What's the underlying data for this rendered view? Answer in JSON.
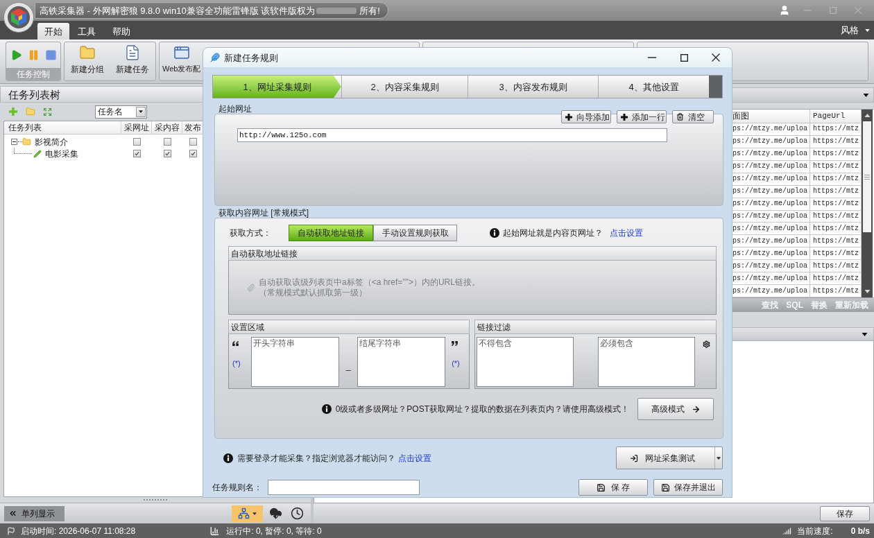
{
  "app": {
    "title": "高铁采集器 - 外网解密狼 9.8.0 win10兼容全功能雷锋版  该软件版权为",
    "title_end": "所有!"
  },
  "menu": {
    "tabs": [
      {
        "label": "开始",
        "selected": true
      },
      {
        "label": "工具",
        "selected": false
      },
      {
        "label": "帮助",
        "selected": false
      }
    ],
    "style_menu": "风格"
  },
  "ribbon": {
    "control_group": "任务控制",
    "buttons": [
      "新建分组",
      "新建任务",
      "Web发布配"
    ]
  },
  "task_tree": {
    "title": "任务列表树",
    "filter": "任务名",
    "columns": [
      "任务列表",
      "采网址",
      "采内容",
      "发布"
    ],
    "nodes": [
      {
        "name": "影视简介",
        "kind": "group",
        "expanded": true,
        "checks": [
          false,
          false,
          false
        ],
        "children": [
          {
            "name": "电影采集",
            "kind": "task",
            "checks": [
              true,
              true,
              true
            ]
          }
        ]
      }
    ],
    "view_toggle": "单列显示"
  },
  "result_table": {
    "columns": [
      "面图",
      "PageUrl"
    ],
    "rows": [
      [
        "ps://mtzy.me/uploa",
        "https://mtz"
      ],
      [
        "ps://mtzy.me/uploa",
        "https://mtz"
      ],
      [
        "ps://mtzy.me/uploa",
        "https://mtz"
      ],
      [
        "ps://mtzy.me/uploa",
        "https://mtz"
      ],
      [
        "ps://mtzy.me/uploa",
        "https://mtz"
      ],
      [
        "ps://mtzy.me/uploa",
        "https://mtz"
      ],
      [
        "ps://mtzy.me/uploa",
        "https://mtz"
      ],
      [
        "ps://mtzy.me/uploa",
        "https://mtz"
      ],
      [
        "ps://mtzy.me/uploa",
        "https://mtz"
      ],
      [
        "ps://mtzy.me/uploa",
        "https://mtz"
      ],
      [
        "ps://mtzy.me/uploa",
        "https://mtz"
      ],
      [
        "ps://mtzy.me/uploa",
        "https://mtz"
      ],
      [
        "ps://mtzy.me/uploa",
        "https://mtz"
      ],
      [
        "ps://mtzy.me/uploa",
        "https://mtz"
      ]
    ],
    "actions": [
      "查找",
      "SQL",
      "替换",
      "重新加载"
    ],
    "save_button": "保存"
  },
  "status_bar": {
    "start_time": "启动时间: 2026-06-07 11:08:28",
    "counts": "运行中: 0, 暂停: 0, 等待: 0",
    "speed_label": "当前速度:",
    "speed": "0 b/s"
  },
  "dialog": {
    "title": "新建任务规则",
    "steps": [
      {
        "label": "1、网址采集规则",
        "selected": true
      },
      {
        "label": "2、内容采集规则",
        "selected": false
      },
      {
        "label": "3、内容发布规则",
        "selected": false
      },
      {
        "label": "4、其他设置",
        "selected": false
      }
    ],
    "start_urls": {
      "label": "起始网址",
      "buttons": [
        "向导添加",
        "添加一行",
        "清空"
      ],
      "url": "http://www.125o.com"
    },
    "content_urls": {
      "label": "获取内容网址 [常规模式]",
      "method_label": "获取方式：",
      "methods": [
        {
          "label": "自动获取地址链接",
          "selected": true
        },
        {
          "label": "手动设置规则获取",
          "selected": false
        }
      ],
      "hint": "起始网址就是内容页网址？",
      "hint_link": "点击设置",
      "auto_panel": {
        "title": "自动获取地址链接",
        "lines": [
          "自动获取该级列表页中a标签（<a href=\"\">）内的URL链接。",
          "（常规模式默认抓取第一级）"
        ]
      },
      "region_panel": {
        "title": "设置区域",
        "start": {
          "placeholder": "开头字符串"
        },
        "separator": "_",
        "end": {
          "placeholder": "结尾字符串"
        },
        "wildcard_left": "(*)",
        "wildcard_right": "(*)"
      },
      "filter_panel": {
        "title": "链接过滤",
        "exclude": {
          "placeholder": "不得包含"
        },
        "include": {
          "placeholder": "必须包含"
        }
      },
      "advanced_hint": "0级或者多级网址？POST获取网址？提取的数据在列表页内？请使用高级模式！",
      "advanced_button": "高级模式"
    },
    "login_hint": "需要登录才能采集？指定浏览器才能访问？",
    "login_link": "点击设置",
    "test_button": "网址采集测试",
    "rule_name_label": "任务规则名：",
    "save_button": "保 存",
    "save_exit_button": "保存并退出"
  }
}
